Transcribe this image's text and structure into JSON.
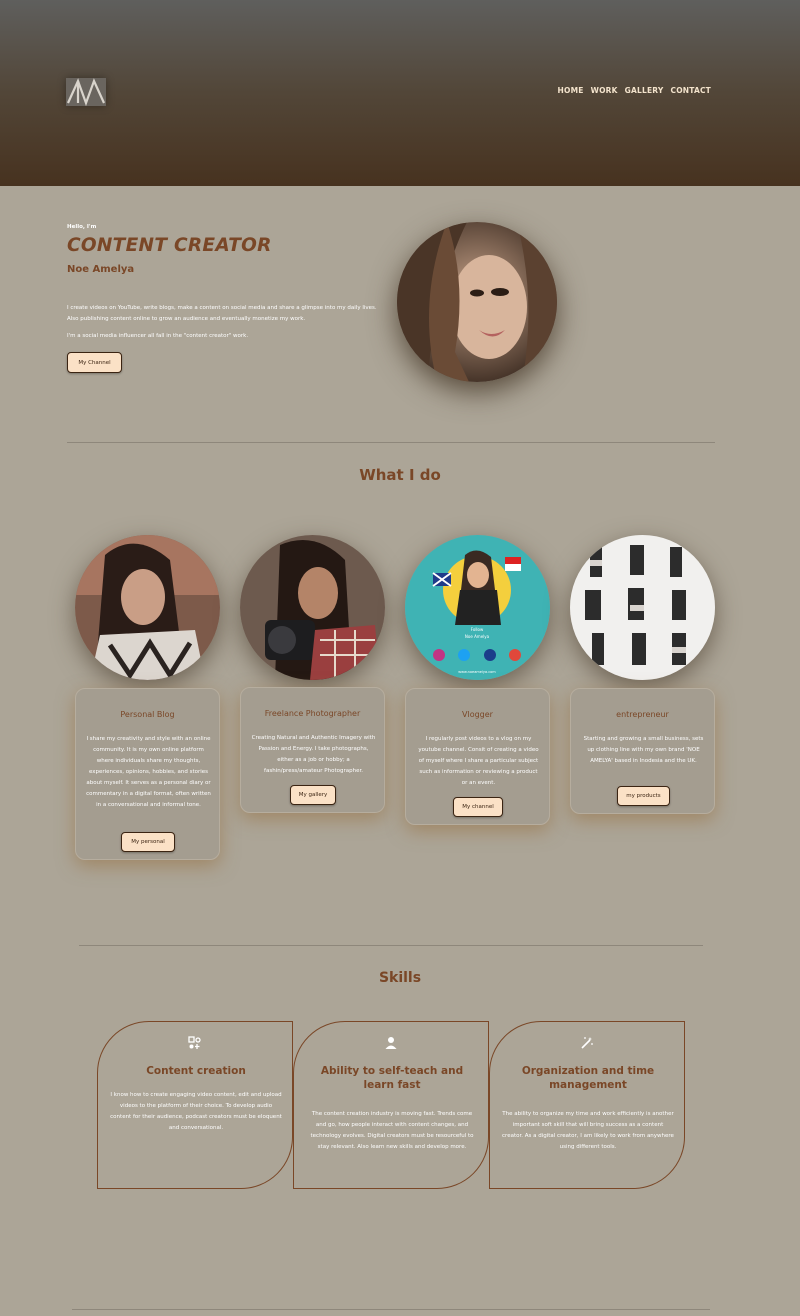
{
  "nav": {
    "logo": "NA",
    "items": [
      "HOME",
      "WORK",
      "GALLERY",
      "CONTACT"
    ]
  },
  "hero": {
    "greeting": "Hello, I'm",
    "title": "CONTENT CREATOR",
    "name": "Noe Amelya",
    "description": "I create videos on YouTube, write blogs, make a content on social media and share a glimpse into my daily lives. Also publishing content online to grow an audience and eventually monetize my work.",
    "description2": "I'm a social media influencer all fall in the \"content creator\" work.",
    "button": "My Channel"
  },
  "what_i_do": {
    "title": "What I do",
    "cards": [
      {
        "title": "Personal Blog",
        "text": "I share my creativity and style with an online community. It is my own online platform where individuals share my thoughts, experiences, opinions, hobbies, and stories about myself. It serves as a personal diary or commentary in a digital format, often written in a conversational and informal tone.",
        "button": "My personal"
      },
      {
        "title": "Freelance Photographer",
        "text": "Creating Natural and Authentic Imagery with Passion and Energy. I take photographs, either as a job or hobby; a fashin/press/amateur Photographer.",
        "button": "My gallery"
      },
      {
        "title": "Vlogger",
        "text": "I regularly post videos to a vlog on my youtube channel. Consit of creating a video of myself where I share a particular subject such as information or reviewing a product or an event.",
        "button": "My channel",
        "poster_name": "Noe Amelya",
        "poster_follow": "Follow",
        "poster_handle": "Noe Amelya",
        "poster_url": "www.noeamelya.com"
      },
      {
        "title": "entrepreneur",
        "text": "Starting and growing a small business, sets up clothing line with my own brand 'NOE AMELYA' based in Inodesia and the UK.",
        "button": "my products"
      }
    ]
  },
  "skills": {
    "title": "Skills",
    "items": [
      {
        "icon": "music-app-icon",
        "title": "Content creation",
        "text": "I know how to create engaging video content, edit and upload videos to the platform of their choice. To develop audio content for their audience, podcast creators must be eloquent and conversational."
      },
      {
        "icon": "person-icon",
        "title": "Ability to self-teach and learn fast",
        "text": "The content creation industry is moving fast. Trends come and go, how people interact with content changes, and technology evolves. Digital creators must be resourceful to stay relevant. Also learn new skills and develop more."
      },
      {
        "icon": "magic-wand-icon",
        "title": "Organization and time management",
        "text": "The ability to organize my time and work efficiently is another important soft skill that will bring success as a content creator. As a digital creator, I am likely to work from anywhere using different tools."
      }
    ]
  },
  "colors": {
    "accent": "#7a4727",
    "background": "#aca597",
    "button": "#fbe1c6"
  }
}
